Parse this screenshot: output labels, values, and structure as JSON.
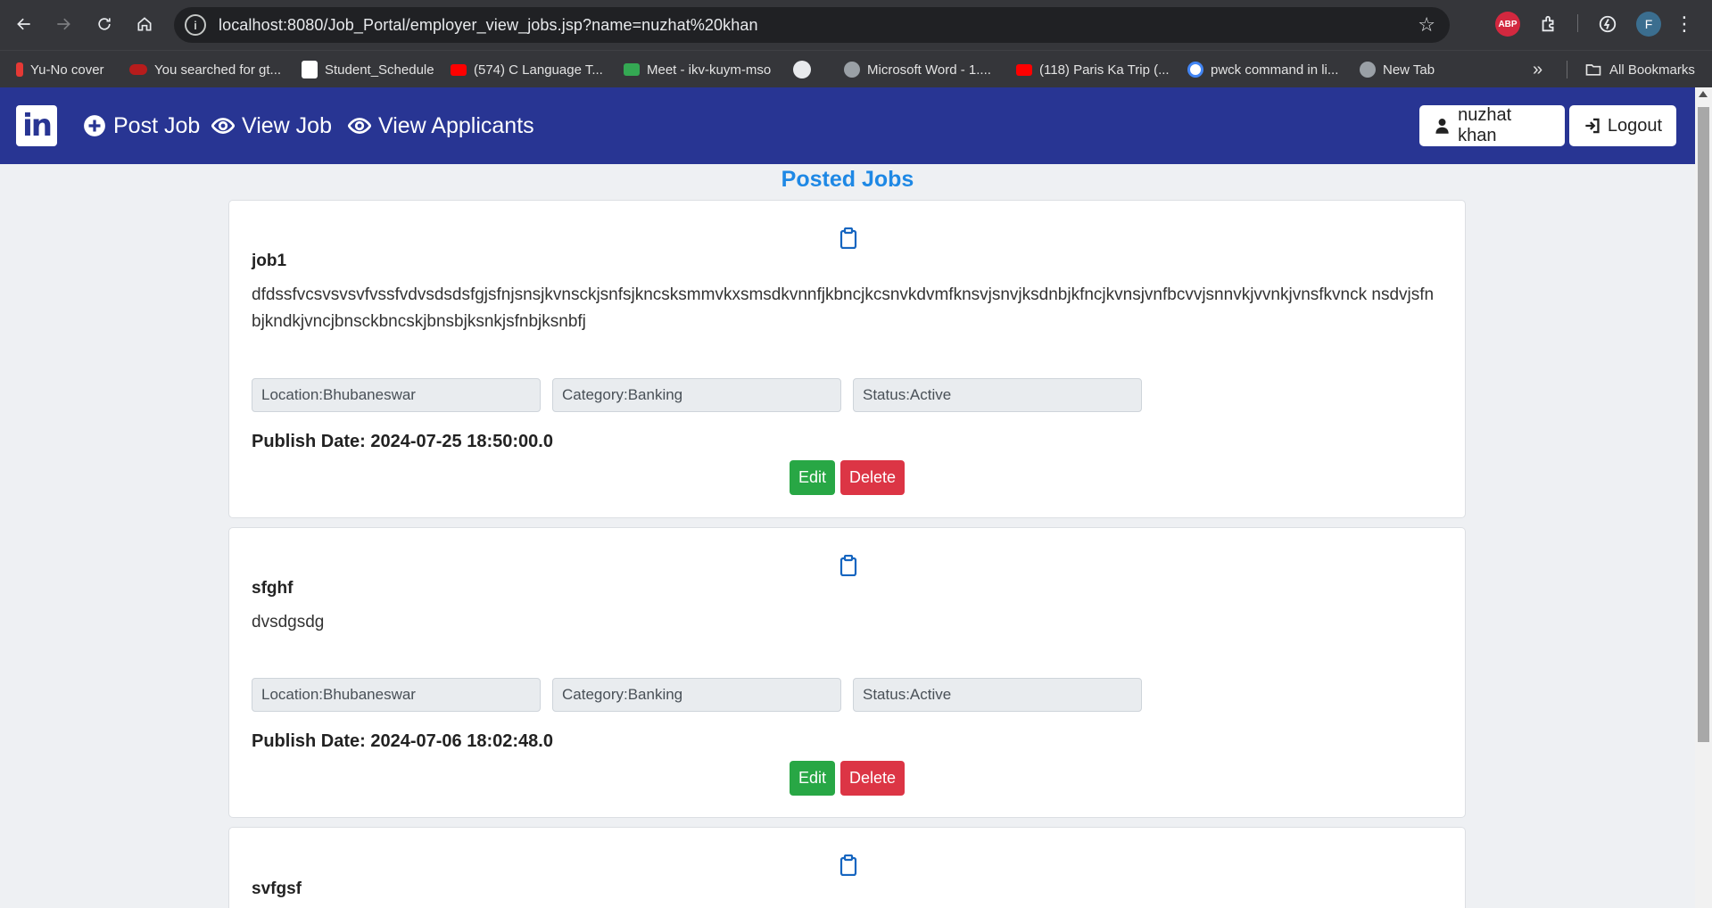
{
  "browser": {
    "url": "localhost:8080/Job_Portal/employer_view_jobs.jsp?name=nuzhat%20khan",
    "abp_label": "ABP",
    "profile_initial": "F",
    "bookmarks": [
      {
        "label": "Yu-No cover",
        "icon_color": "#e53935"
      },
      {
        "label": "You searched for gt...",
        "icon_color": "#b71c1c"
      },
      {
        "label": "Student_Schedule",
        "icon_color": "#ffffff"
      },
      {
        "label": "(574) C Language T...",
        "icon_color": "#ff0000"
      },
      {
        "label": "Meet - ikv-kuym-mso",
        "icon_color": "#34a853"
      },
      {
        "label": "",
        "icon_color": "#e8eaed"
      },
      {
        "label": "Microsoft Word - 1....",
        "icon_color": "#9aa0a6"
      },
      {
        "label": "(118) Paris Ka Trip (...",
        "icon_color": "#ff0000"
      },
      {
        "label": "pwck command in li...",
        "icon_color": "#4285f4"
      },
      {
        "label": "New Tab",
        "icon_color": "#9aa0a6"
      }
    ],
    "all_bookmarks_label": "All Bookmarks"
  },
  "navbar": {
    "logo_text": "in",
    "post_job": "Post Job",
    "view_job": "View Job",
    "view_applicants": "View Applicants",
    "user_name": "nuzhat khan",
    "logout": "Logout",
    "brand_color": "#283593"
  },
  "page": {
    "title": "Posted Jobs"
  },
  "jobs": [
    {
      "title": "job1",
      "description": "dfdssfvcsvsvsvfvssfvdvsdsdsfgjsfnjsnsjkvnsckjsnfsjkncsksmmvkxsmsdkvnnfjkbncjkcsnvkdvmfknsvjsnvjksdnbjkfncjkvnsjvnfbcvvjsnnvkjvvnkjvnsfkvnck nsdvjsfnbjkndkjvncjbnsckbncskjbnsbjksnkjsfnbjksnbfj",
      "location": "Location:Bhubaneswar",
      "category": "Category:Banking",
      "status": "Status:Active",
      "publish_date": "Publish Date: 2024-07-25 18:50:00.0",
      "edit_label": "Edit",
      "delete_label": "Delete"
    },
    {
      "title": "sfghf",
      "description": "dvsdgsdg",
      "location": "Location:Bhubaneswar",
      "category": "Category:Banking",
      "status": "Status:Active",
      "publish_date": "Publish Date: 2024-07-06 18:02:48.0",
      "edit_label": "Edit",
      "delete_label": "Delete"
    },
    {
      "title": "svfgsf"
    }
  ]
}
